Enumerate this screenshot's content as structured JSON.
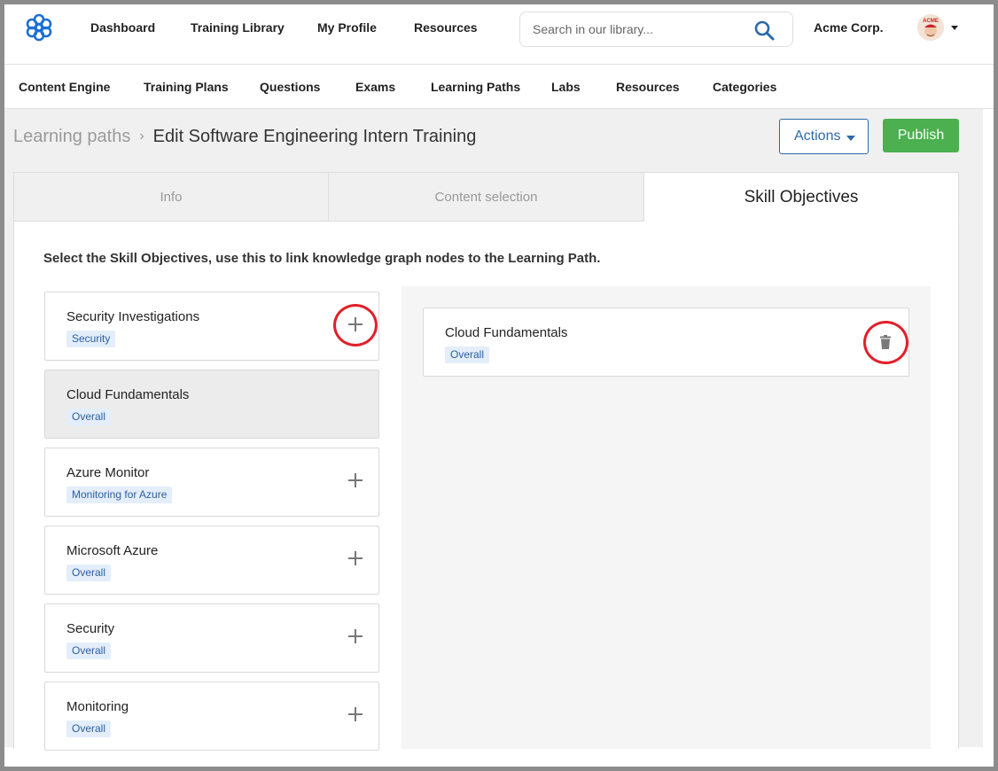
{
  "header": {
    "nav": [
      "Dashboard",
      "Training Library",
      "My Profile",
      "Resources"
    ],
    "search_placeholder": "Search in our library...",
    "org_name": "Acme Corp.",
    "avatar_text": "ACME"
  },
  "subnav": [
    "Content Engine",
    "Training Plans",
    "Questions",
    "Exams",
    "Learning Paths",
    "Labs",
    "Resources",
    "Categories"
  ],
  "breadcrumb": {
    "parent": "Learning paths",
    "separator": "›",
    "current": "Edit Software Engineering Intern Training"
  },
  "actions": {
    "actions_label": "Actions",
    "publish_label": "Publish"
  },
  "tabs": [
    "Info",
    "Content selection",
    "Skill Objectives"
  ],
  "active_tab": "Skill Objectives",
  "instructions": "Select the Skill Objectives, use this to link knowledge graph nodes to the Learning Path.",
  "available_skills": [
    {
      "name": "Security Investigations",
      "tag": "Security",
      "selected": false
    },
    {
      "name": "Cloud Fundamentals",
      "tag": "Overall",
      "selected": true
    },
    {
      "name": "Azure Monitor",
      "tag": "Monitoring for Azure",
      "selected": false
    },
    {
      "name": "Microsoft Azure",
      "tag": "Overall",
      "selected": false
    },
    {
      "name": "Security",
      "tag": "Overall",
      "selected": false
    },
    {
      "name": "Monitoring",
      "tag": "Overall",
      "selected": false
    }
  ],
  "selected_skills": [
    {
      "name": "Cloud Fundamentals",
      "tag": "Overall"
    }
  ],
  "colors": {
    "accent_blue": "#2c6aa8",
    "publish_green": "#4caf50",
    "highlight_ring": "#e0202a",
    "tag_bg": "#e4eefa"
  },
  "icons": [
    "app-logo-icon",
    "search-icon",
    "chevron-down-icon",
    "plus-icon",
    "trash-icon"
  ]
}
